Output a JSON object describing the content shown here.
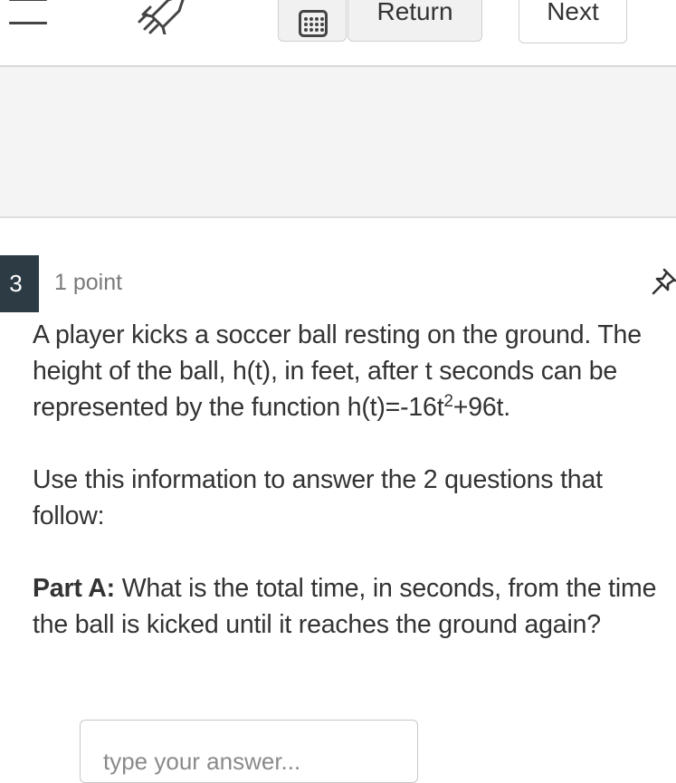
{
  "toolbar": {
    "menu_icon": "hamburger-icon",
    "rocket_icon": "rocket-icon",
    "calculator_icon": "calculator-icon",
    "return_label": "Return",
    "next_label": "Next"
  },
  "question": {
    "number": "3",
    "points": "1 point",
    "pin_icon": "pin-icon",
    "text_line1": "A player kicks a soccer ball resting on the ground. The height of the ball, h(t), in feet, after t seconds can be represented by the function h(t)=-16t",
    "exponent": "2",
    "text_line1_end": "+96t.",
    "instruction": "Use this information to answer the 2 questions that follow:",
    "part_label": "Part A:",
    "part_text": " What is the total time, in seconds, from the time the ball is kicked until it reaches the ground again?",
    "answer_value": "",
    "answer_placeholder": "type your answer..."
  },
  "colors": {
    "question_number_bg": "#2d3b45",
    "band_bg": "#f4f4f4"
  }
}
